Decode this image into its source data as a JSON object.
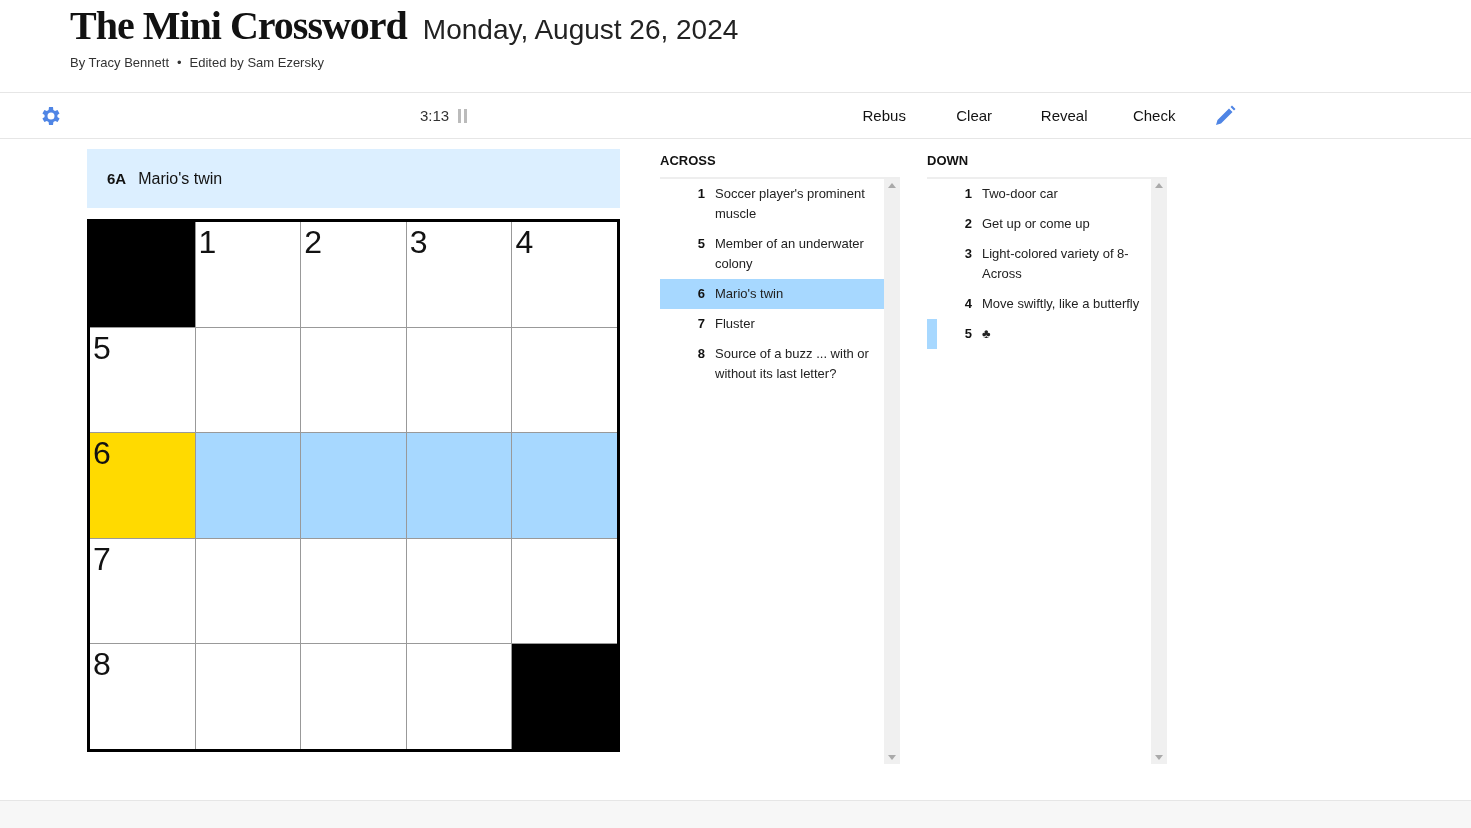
{
  "header": {
    "title": "The Mini Crossword",
    "date": "Monday, August 26, 2024",
    "byline": "By Tracy Bennett",
    "separator": "•",
    "editor": "Edited by Sam Ezersky"
  },
  "toolbar": {
    "timer": "3:13",
    "paused": false,
    "buttons": [
      "Rebus",
      "Clear",
      "Reveal",
      "Check"
    ]
  },
  "current_clue": {
    "label": "6A",
    "text": "Mario's twin"
  },
  "grid": [
    [
      {
        "kind": "block"
      },
      {
        "kind": "open",
        "number": "1",
        "selected": false,
        "highlighted": false
      },
      {
        "kind": "open",
        "number": "2",
        "selected": false,
        "highlighted": false
      },
      {
        "kind": "open",
        "number": "3",
        "selected": false,
        "highlighted": false
      },
      {
        "kind": "open",
        "number": "4",
        "selected": false,
        "highlighted": false
      }
    ],
    [
      {
        "kind": "open",
        "number": "5",
        "selected": false,
        "highlighted": false
      },
      {
        "kind": "open",
        "selected": false,
        "highlighted": false
      },
      {
        "kind": "open",
        "selected": false,
        "highlighted": false
      },
      {
        "kind": "open",
        "selected": false,
        "highlighted": false
      },
      {
        "kind": "open",
        "selected": false,
        "highlighted": false
      }
    ],
    [
      {
        "kind": "open",
        "number": "6",
        "selected": true,
        "highlighted": false
      },
      {
        "kind": "open",
        "selected": false,
        "highlighted": true
      },
      {
        "kind": "open",
        "selected": false,
        "highlighted": true
      },
      {
        "kind": "open",
        "selected": false,
        "highlighted": true
      },
      {
        "kind": "open",
        "selected": false,
        "highlighted": true
      }
    ],
    [
      {
        "kind": "open",
        "number": "7",
        "selected": false,
        "highlighted": false
      },
      {
        "kind": "open",
        "selected": false,
        "highlighted": false
      },
      {
        "kind": "open",
        "selected": false,
        "highlighted": false
      },
      {
        "kind": "open",
        "selected": false,
        "highlighted": false
      },
      {
        "kind": "open",
        "selected": false,
        "highlighted": false
      }
    ],
    [
      {
        "kind": "open",
        "number": "8",
        "selected": false,
        "highlighted": false
      },
      {
        "kind": "open",
        "selected": false,
        "highlighted": false
      },
      {
        "kind": "open",
        "selected": false,
        "highlighted": false
      },
      {
        "kind": "open",
        "selected": false,
        "highlighted": false
      },
      {
        "kind": "block"
      }
    ]
  ],
  "clue_lists": [
    {
      "title": "ACROSS",
      "clues": [
        {
          "number": "1",
          "text": "Soccer player's prominent muscle",
          "selected": false,
          "crossing": false
        },
        {
          "number": "5",
          "text": "Member of an underwater colony",
          "selected": false,
          "crossing": false
        },
        {
          "number": "6",
          "text": "Mario's twin",
          "selected": true,
          "crossing": false
        },
        {
          "number": "7",
          "text": "Fluster",
          "selected": false,
          "crossing": false
        },
        {
          "number": "8",
          "text": "Source of a buzz ... with or without its last letter?",
          "selected": false,
          "crossing": false
        }
      ]
    },
    {
      "title": "DOWN",
      "clues": [
        {
          "number": "1",
          "text": "Two-door car",
          "selected": false,
          "crossing": false
        },
        {
          "number": "2",
          "text": "Get up or come up",
          "selected": false,
          "crossing": false
        },
        {
          "number": "3",
          "text": "Light-colored variety of 8-Across",
          "selected": false,
          "crossing": false
        },
        {
          "number": "4",
          "text": "Move swiftly, like a butterfly",
          "selected": false,
          "crossing": false
        },
        {
          "number": "5",
          "text": "♣",
          "selected": false,
          "crossing": true
        }
      ]
    }
  ]
}
